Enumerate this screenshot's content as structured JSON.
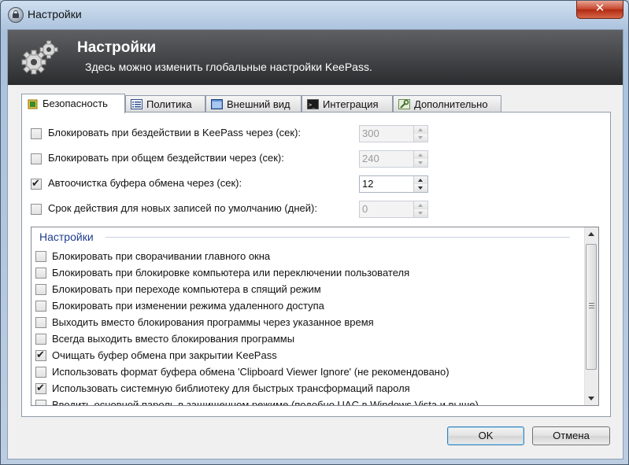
{
  "window": {
    "title": "Настройки",
    "close_glyph": "✕"
  },
  "banner": {
    "title": "Настройки",
    "subtitle": "Здесь можно изменить глобальные настройки KeePass.",
    "icon": "gears-icon"
  },
  "tabs": [
    {
      "label": "Безопасность",
      "icon": "shield-icon",
      "active": true
    },
    {
      "label": "Политика",
      "icon": "list-icon",
      "active": false
    },
    {
      "label": "Внешний вид",
      "icon": "window-icon",
      "active": false
    },
    {
      "label": "Интеграция",
      "icon": "console-icon",
      "active": false
    },
    {
      "label": "Дополнительно",
      "icon": "wrench-icon",
      "active": false
    }
  ],
  "security": {
    "rows": [
      {
        "label": "Блокировать при бездействии в KeePass через (сек):",
        "checked": false,
        "value": "300",
        "enabled": false
      },
      {
        "label": "Блокировать при общем бездействии через (сек):",
        "checked": false,
        "value": "240",
        "enabled": false
      },
      {
        "label": "Автоочистка буфера обмена через (сек):",
        "checked": true,
        "value": "12",
        "enabled": true
      },
      {
        "label": "Срок действия для новых записей по умолчанию (дней):",
        "checked": false,
        "value": "0",
        "enabled": false
      }
    ],
    "group_header": "Настройки",
    "options": [
      {
        "label": "Блокировать при сворачивании главного окна",
        "checked": false
      },
      {
        "label": "Блокировать при блокировке компьютера или переключении пользователя",
        "checked": false
      },
      {
        "label": "Блокировать при переходе компьютера в спящий режим",
        "checked": false
      },
      {
        "label": "Блокировать при изменении режима удаленного доступа",
        "checked": false
      },
      {
        "label": "Выходить вместо блокирования программы через указанное время",
        "checked": false
      },
      {
        "label": "Всегда выходить вместо блокирования программы",
        "checked": false
      },
      {
        "label": "Очищать буфер обмена при закрытии KeePass",
        "checked": true
      },
      {
        "label": "Использовать формат буфера обмена 'Clipboard Viewer Ignore' (не рекомендовано)",
        "checked": false
      },
      {
        "label": "Использовать системную библиотеку для быстрых трансформаций пароля",
        "checked": true
      },
      {
        "label": "Вводить основной пароль в защищенном режиме (подобно UAC в Windows Vista и выше)",
        "checked": false
      }
    ]
  },
  "buttons": {
    "ok": "OK",
    "cancel": "Отмена"
  }
}
